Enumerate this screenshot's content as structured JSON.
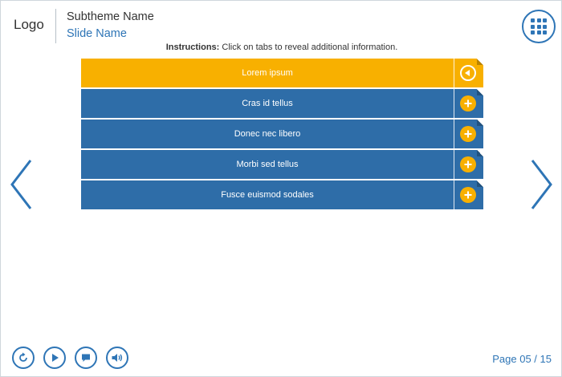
{
  "header": {
    "logo": "Logo",
    "subtheme": "Subtheme Name",
    "slide_name": "Slide Name"
  },
  "instructions": {
    "label": "Instructions:",
    "text": "Click on tabs to reveal additional information."
  },
  "tabs": [
    {
      "label": "Lorem ipsum",
      "state": "active",
      "icon": "collapse-arrow-icon"
    },
    {
      "label": "Cras id tellus",
      "state": "collapsed",
      "icon": "plus-icon"
    },
    {
      "label": "Donec nec libero",
      "state": "collapsed",
      "icon": "plus-icon"
    },
    {
      "label": "Morbi sed tellus",
      "state": "collapsed",
      "icon": "plus-icon"
    },
    {
      "label": "Fusce euismod sodales",
      "state": "collapsed",
      "icon": "plus-icon"
    }
  ],
  "footer": {
    "page_indicator": "Page 05 / 15",
    "controls": [
      "replay-icon",
      "play-icon",
      "comment-icon",
      "audio-icon"
    ]
  },
  "colors": {
    "primary_blue": "#2e6da8",
    "accent_blue": "#2e75b6",
    "active_orange": "#f8b000"
  }
}
